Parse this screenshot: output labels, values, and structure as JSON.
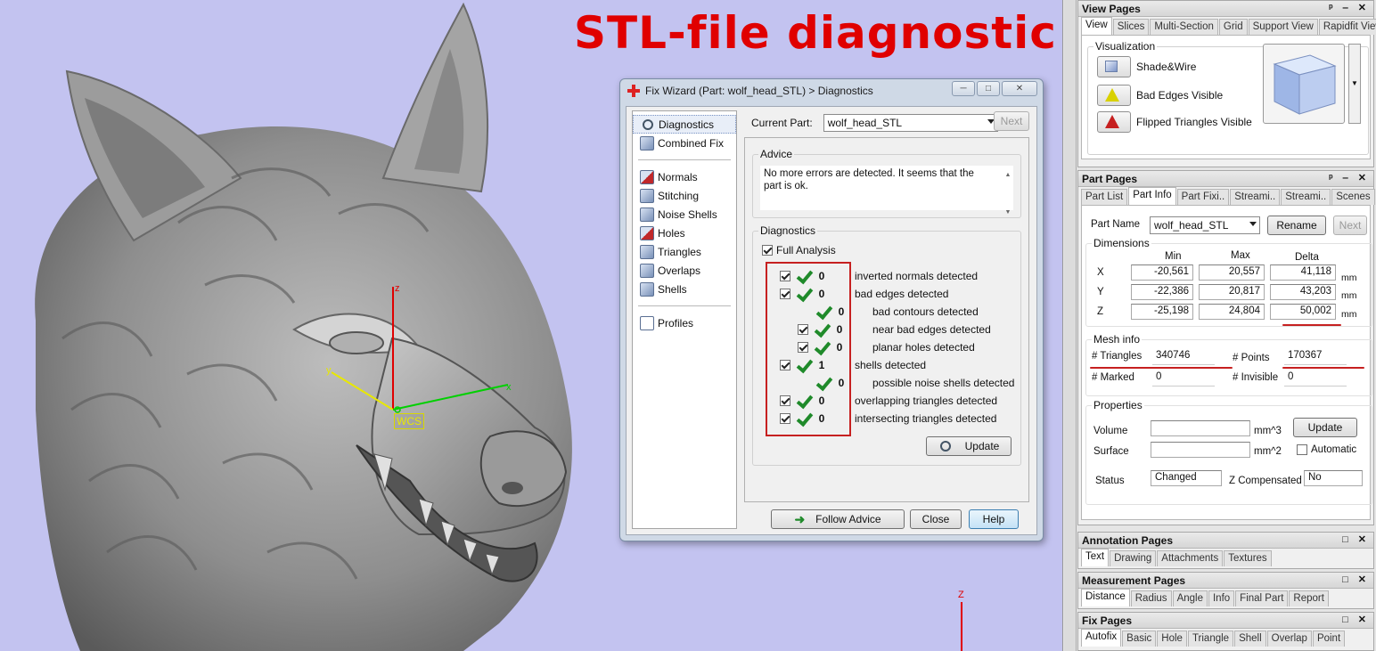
{
  "headline": "STL-file diagnostic",
  "viewport": {
    "wcs_label": "WCS",
    "axis_z": "z",
    "axis_x": "x",
    "axis_y": "y",
    "axis_z2": "Z"
  },
  "wizard": {
    "title": "Fix Wizard (Part: wolf_head_STL) > Diagnostics",
    "win_min": "─",
    "win_max": "□",
    "win_close": "✕",
    "nav": [
      {
        "label": "Diagnostics",
        "icon": "magnifier-icon"
      },
      {
        "label": "Combined Fix",
        "icon": "cube-icon"
      },
      {
        "label": "Normals",
        "icon": "normals-cube-icon"
      },
      {
        "label": "Stitching",
        "icon": "stitching-cube-icon"
      },
      {
        "label": "Noise Shells",
        "icon": "noise-shells-icon"
      },
      {
        "label": "Holes",
        "icon": "holes-cube-icon"
      },
      {
        "label": "Triangles",
        "icon": "triangles-cube-icon"
      },
      {
        "label": "Overlaps",
        "icon": "overlaps-cube-icon"
      },
      {
        "label": "Shells",
        "icon": "shells-cube-icon"
      },
      {
        "label": "Profiles",
        "icon": "document-icon"
      }
    ],
    "current_part_label": "Current Part:",
    "current_part_value": "wolf_head_STL",
    "next_label": "Next",
    "advice_title": "Advice",
    "advice_text": "No more errors are detected. It seems that the part is ok.",
    "diagnostics_title": "Diagnostics",
    "full_analysis_label": "Full Analysis",
    "rows": [
      {
        "count": "0",
        "label": "inverted normals detected"
      },
      {
        "count": "0",
        "label": "bad edges detected"
      },
      {
        "count": "0",
        "label": "bad contours detected"
      },
      {
        "count": "0",
        "label": "near bad edges detected"
      },
      {
        "count": "0",
        "label": "planar holes detected"
      },
      {
        "count": "1",
        "label": "shells detected"
      },
      {
        "count": "0",
        "label": "possible noise shells detected"
      },
      {
        "count": "0",
        "label": "overlapping triangles detected"
      },
      {
        "count": "0",
        "label": "intersecting triangles detected"
      }
    ],
    "update_label": "Update",
    "follow_advice_label": "Follow Advice",
    "close_label": "Close",
    "help_label": "Help"
  },
  "view_pages": {
    "title": "View Pages",
    "tabs": [
      "View",
      "Slices",
      "Multi-Section",
      "Grid",
      "Support View",
      "Rapidfit View"
    ],
    "visualization_title": "Visualization",
    "items": [
      "Shade&Wire",
      "Bad Edges Visible",
      "Flipped Triangles Visible"
    ]
  },
  "part_pages": {
    "title": "Part Pages",
    "tabs": [
      "Part List",
      "Part Info",
      "Part Fixi..",
      "Streami..",
      "Streami..",
      "Scenes"
    ],
    "part_name_label": "Part Name",
    "part_name_value": "wolf_head_STL",
    "rename_label": "Rename",
    "next_label": "Next",
    "dimensions_title": "Dimensions",
    "col_min": "Min",
    "col_max": "Max",
    "col_delta": "Delta",
    "dims": [
      {
        "axis": "X",
        "min": "-20,561",
        "max": "20,557",
        "delta": "41,118",
        "unit": "mm"
      },
      {
        "axis": "Y",
        "min": "-22,386",
        "max": "20,817",
        "delta": "43,203",
        "unit": "mm"
      },
      {
        "axis": "Z",
        "min": "-25,198",
        "max": "24,804",
        "delta": "50,002",
        "unit": "mm"
      }
    ],
    "mesh_title": "Mesh info",
    "triangles_label": "# Triangles",
    "triangles_value": "340746",
    "points_label": "# Points",
    "points_value": "170367",
    "marked_label": "# Marked",
    "marked_value": "0",
    "invisible_label": "# Invisible",
    "invisible_value": "0",
    "properties_title": "Properties",
    "volume_label": "Volume",
    "volume_unit": "mm^3",
    "surface_label": "Surface",
    "surface_unit": "mm^2",
    "update_label": "Update",
    "automatic_label": "Automatic",
    "status_label": "Status",
    "status_value": "Changed",
    "zcomp_label": "Z Compensated",
    "zcomp_value": "No"
  },
  "annotation_pages": {
    "title": "Annotation Pages",
    "tabs": [
      "Text",
      "Drawing",
      "Attachments",
      "Textures"
    ]
  },
  "measurement_pages": {
    "title": "Measurement Pages",
    "tabs": [
      "Distance",
      "Radius",
      "Angle",
      "Info",
      "Final Part",
      "Report"
    ]
  },
  "fix_pages": {
    "title": "Fix Pages",
    "tabs": [
      "Autofix",
      "Basic",
      "Hole",
      "Triangle",
      "Shell",
      "Overlap",
      "Point"
    ]
  },
  "colors": {
    "accent_red": "#c62020",
    "headline_red": "#e00000",
    "check_green": "#1f8a2a",
    "viewport_bg": "#c3c3f0"
  }
}
